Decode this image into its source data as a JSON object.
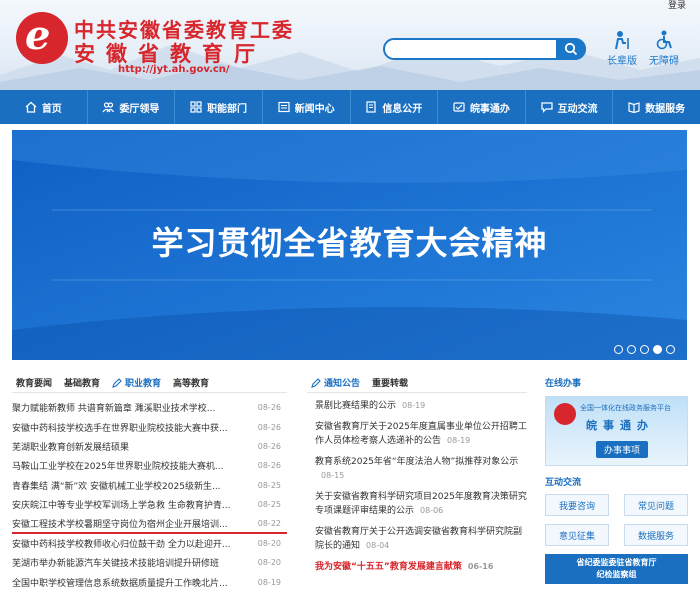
{
  "header": {
    "login_label": "登录",
    "title_line1": "中共安徽省委教育工委",
    "title_line2": "安徽省教育厅",
    "url": "http://jyt.ah.gov.cn/",
    "search_placeholder": "",
    "tools": [
      {
        "label": "长辈版",
        "icon": "elder-icon"
      },
      {
        "label": "无障碍",
        "icon": "accessibility-icon"
      }
    ],
    "brand_color": "#d7262c",
    "accent_color": "#1a6fc0"
  },
  "nav": {
    "items": [
      {
        "label": "首页",
        "icon": "home-icon"
      },
      {
        "label": "委厅领导",
        "icon": "leaders-icon"
      },
      {
        "label": "职能部门",
        "icon": "department-icon"
      },
      {
        "label": "新闻中心",
        "icon": "news-icon"
      },
      {
        "label": "信息公开",
        "icon": "info-icon"
      },
      {
        "label": "皖事通办",
        "icon": "service-icon"
      },
      {
        "label": "互动交流",
        "icon": "chat-icon"
      },
      {
        "label": "数据服务",
        "icon": "data-icon"
      }
    ]
  },
  "banner": {
    "text": "学习贯彻全省教育大会精神",
    "dot_count": 5,
    "active_dot": 4
  },
  "news": {
    "tabs": [
      "教育要闻",
      "基础教育",
      "职业教育",
      "高等教育"
    ],
    "active_tab": "职业教育",
    "items": [
      {
        "title": "聚力赋能新教师 共谱育新篇章 濉溪职业技术学校...",
        "date": "08-26"
      },
      {
        "title": "安徽中药科技学校选手在世界职业院校技能大赛中获...",
        "date": "08-26"
      },
      {
        "title": "芜湖职业教育创新发展结硕果",
        "date": "08-26"
      },
      {
        "title": "马鞍山工业学校在2025年世界职业院校技能大赛机...",
        "date": "08-26"
      },
      {
        "title": "青春集结 满“新”欢 安徽机械工业学校2025级新生...",
        "date": "08-25"
      },
      {
        "title": "安庆皖江中等专业学校军训场上学急救 生命教育护青...",
        "date": "08-25"
      },
      {
        "title": "安徽工程技术学校暑期坚守岗位为宿州企业开展培训...",
        "date": "08-22"
      },
      {
        "title": "安徽中药科技学校教师收心归位鼓干劲 全力以赴迎开...",
        "date": "08-20"
      },
      {
        "title": "芜湖市举办新能源汽车关键技术技能培训提升研修班",
        "date": "08-20"
      },
      {
        "title": "全国中职学校管理信息系统数据质量提升工作晚北片...",
        "date": "08-19"
      }
    ]
  },
  "notices": {
    "tabs": [
      "通知公告",
      "重要转载"
    ],
    "active_tab": "通知公告",
    "items": [
      {
        "title": "景剧比赛结果的公示",
        "date": "08-19",
        "red": false
      },
      {
        "title": "安徽省教育厅关于2025年度直属事业单位公开招聘工作人员体检考察人选递补的公告",
        "date": "08-19",
        "red": false
      },
      {
        "title": "教育系统2025年省“年度法治人物”拟推荐对象公示",
        "date": "08-15",
        "red": false
      },
      {
        "title": "关于安徽省教育科学研究项目2025年度教育决策研究专项课题评审结果的公示",
        "date": "08-06",
        "red": false
      },
      {
        "title": "安徽省教育厅关于公开选调安徽省教育科学研究院副院长的通知",
        "date": "08-04",
        "red": false
      },
      {
        "title": "我为安徽“十五五”教育发展建言献策",
        "date": "06-16",
        "red": true
      }
    ]
  },
  "sidebar": {
    "online_title": "在线办事",
    "card_line1": "全国一体化在线政务服务平台",
    "card_line2": "皖事通办",
    "card_button": "办事事项",
    "interact_title": "互动交流",
    "buttons": [
      "我要咨询",
      "常见问题",
      "意见征集",
      "数据服务"
    ],
    "jiwei_line1": "省纪委监委驻省教育厅",
    "jiwei_line2": "纪检监察组"
  }
}
